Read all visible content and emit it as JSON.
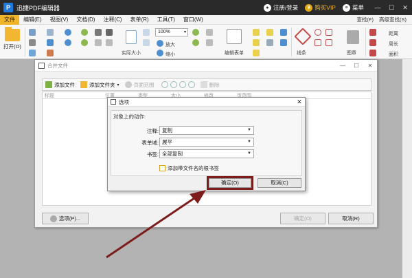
{
  "app": {
    "logo": "P",
    "title": "迅捷PDF编辑器",
    "login": "注册/登录",
    "vip_badge": "¥",
    "vip": "购买VIP",
    "menu": "菜单",
    "minimize": "—",
    "maximize": "☐",
    "close": "✕"
  },
  "menubar": {
    "items": [
      "文件",
      "编辑(E)",
      "视图(V)",
      "文档(D)",
      "注释(C)",
      "表单(R)",
      "工具(T)",
      "窗口(W)"
    ],
    "find": "查找(F)",
    "advanced_find": "高级查找(S)"
  },
  "ribbon": {
    "open": "打开(O)",
    "zoom_value": "100%",
    "zoom_in": "放大",
    "shrink": "缩小",
    "actual_size": "实际大小",
    "edit_form": "编辑表单",
    "lines": "线条",
    "stamp": "图章",
    "distance": "距离",
    "perimeter": "周长",
    "area": "面积"
  },
  "merge_dialog": {
    "title": "合并文件",
    "toolbar": {
      "add_file": "添加文件",
      "add_folder": "添加文件夹",
      "add_folder_caret": "▾",
      "page_range": "页面范围",
      "delete": "删除"
    },
    "columns": [
      "标题",
      "位置",
      "类型",
      "大小",
      "修改",
      "页范围"
    ],
    "options_button": "选项(P)...",
    "ok_button": "确定(O)",
    "cancel_button": "取消(R)"
  },
  "options_dialog": {
    "title": "选项",
    "group_title": "对象上的动作:",
    "annotation_label": "注释:",
    "annotation_value": "复制",
    "form_label": "表单域:",
    "form_value": "展平",
    "bookmark_label": "书签:",
    "bookmark_value": "全部复制",
    "checkbox_label": "添加带文件名的根书签",
    "checkbox_checked": false,
    "ok_button": "确定(O)",
    "cancel_button": "取消(C)",
    "close": "✕"
  },
  "colors": {
    "accent": "#f0b428",
    "highlight_frame": "#7d1c1c",
    "arrow": "#7d1c1c"
  }
}
